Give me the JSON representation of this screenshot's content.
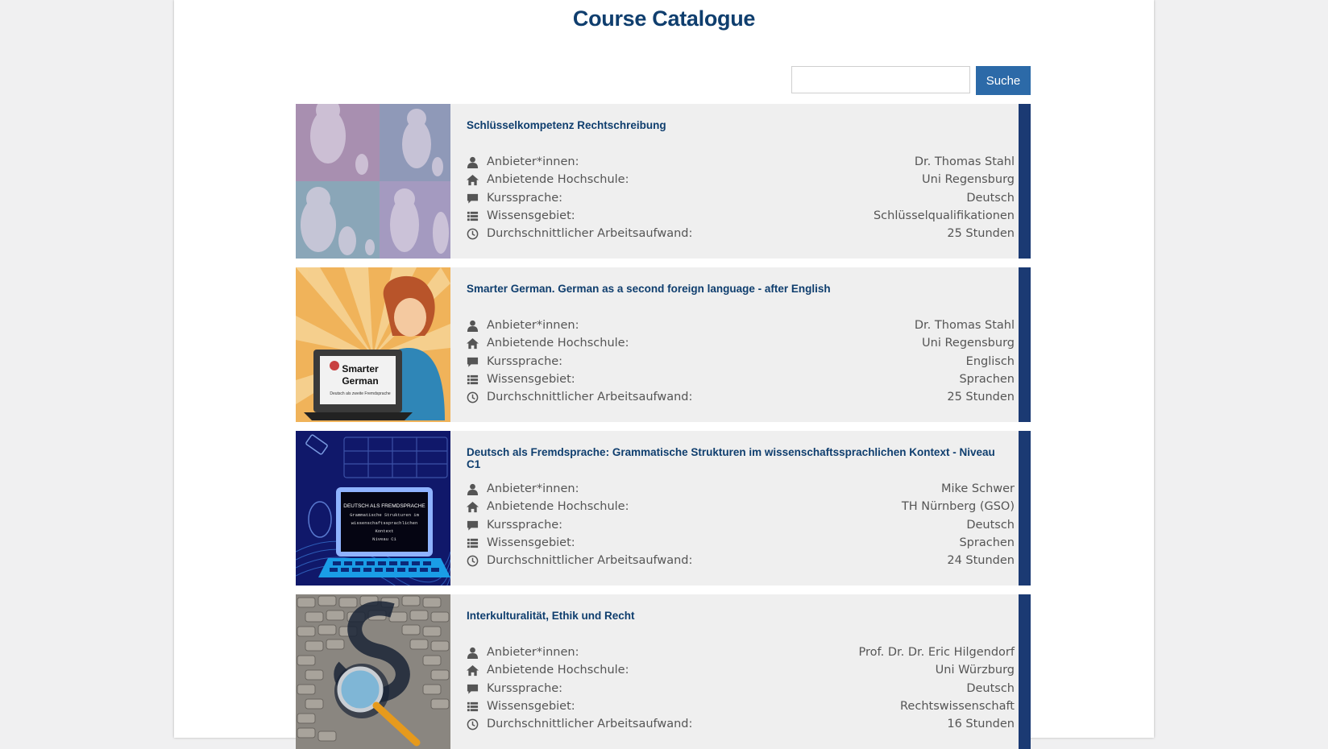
{
  "page": {
    "title": "Course Catalogue"
  },
  "search": {
    "placeholder": "",
    "button_label": "Suche"
  },
  "labels": {
    "provider": "Anbieter*innen:",
    "university": "Anbietende Hochschule:",
    "language": "Kurssprache:",
    "field": "Wissensgebiet:",
    "workload": "Durchschnittlicher Arbeitsaufwand:"
  },
  "icons": {
    "provider": "user-icon",
    "university": "home-icon",
    "language": "comment-icon",
    "field": "list-icon",
    "workload": "clock-icon"
  },
  "colors": {
    "brand": "#0f3e6e",
    "button": "#2c6aa8",
    "accent_bar": "#1b3a73"
  },
  "courses": [
    {
      "title": "Schlüsselkompetenz Rechtschreibung",
      "provider": "Dr. Thomas Stahl",
      "university": "Uni Regensburg",
      "language": "Deutsch",
      "field": "Schlüsselqualifikationen",
      "workload": "25 Stunden"
    },
    {
      "title": "Smarter German. German as a second foreign language - after English",
      "provider": "Dr. Thomas Stahl",
      "university": "Uni Regensburg",
      "language": "Englisch",
      "field": "Sprachen",
      "workload": "25 Stunden",
      "thumb_text": [
        "Smarter",
        "German",
        "Deutsch als zweite Fremdsprache"
      ]
    },
    {
      "title": "Deutsch als Fremdsprache: Grammatische Strukturen im wissenschaftssprachlichen Kontext - Niveau C1",
      "provider": "Mike Schwer",
      "university": "TH Nürnberg (GSO)",
      "language": "Deutsch",
      "field": "Sprachen",
      "workload": "24 Stunden",
      "thumb_text": [
        "DEUTSCH ALS FREMDSPRACHE",
        "Grammatische Strukturen im",
        "wissenschaftssprachlichen",
        "Kontext",
        "Niveau C1"
      ]
    },
    {
      "title": "Interkulturalität, Ethik und Recht",
      "provider": "Prof. Dr. Dr. Eric Hilgendorf",
      "university": "Uni Würzburg",
      "language": "Deutsch",
      "field": "Rechtswissenschaft",
      "workload": "16 Stunden"
    }
  ]
}
